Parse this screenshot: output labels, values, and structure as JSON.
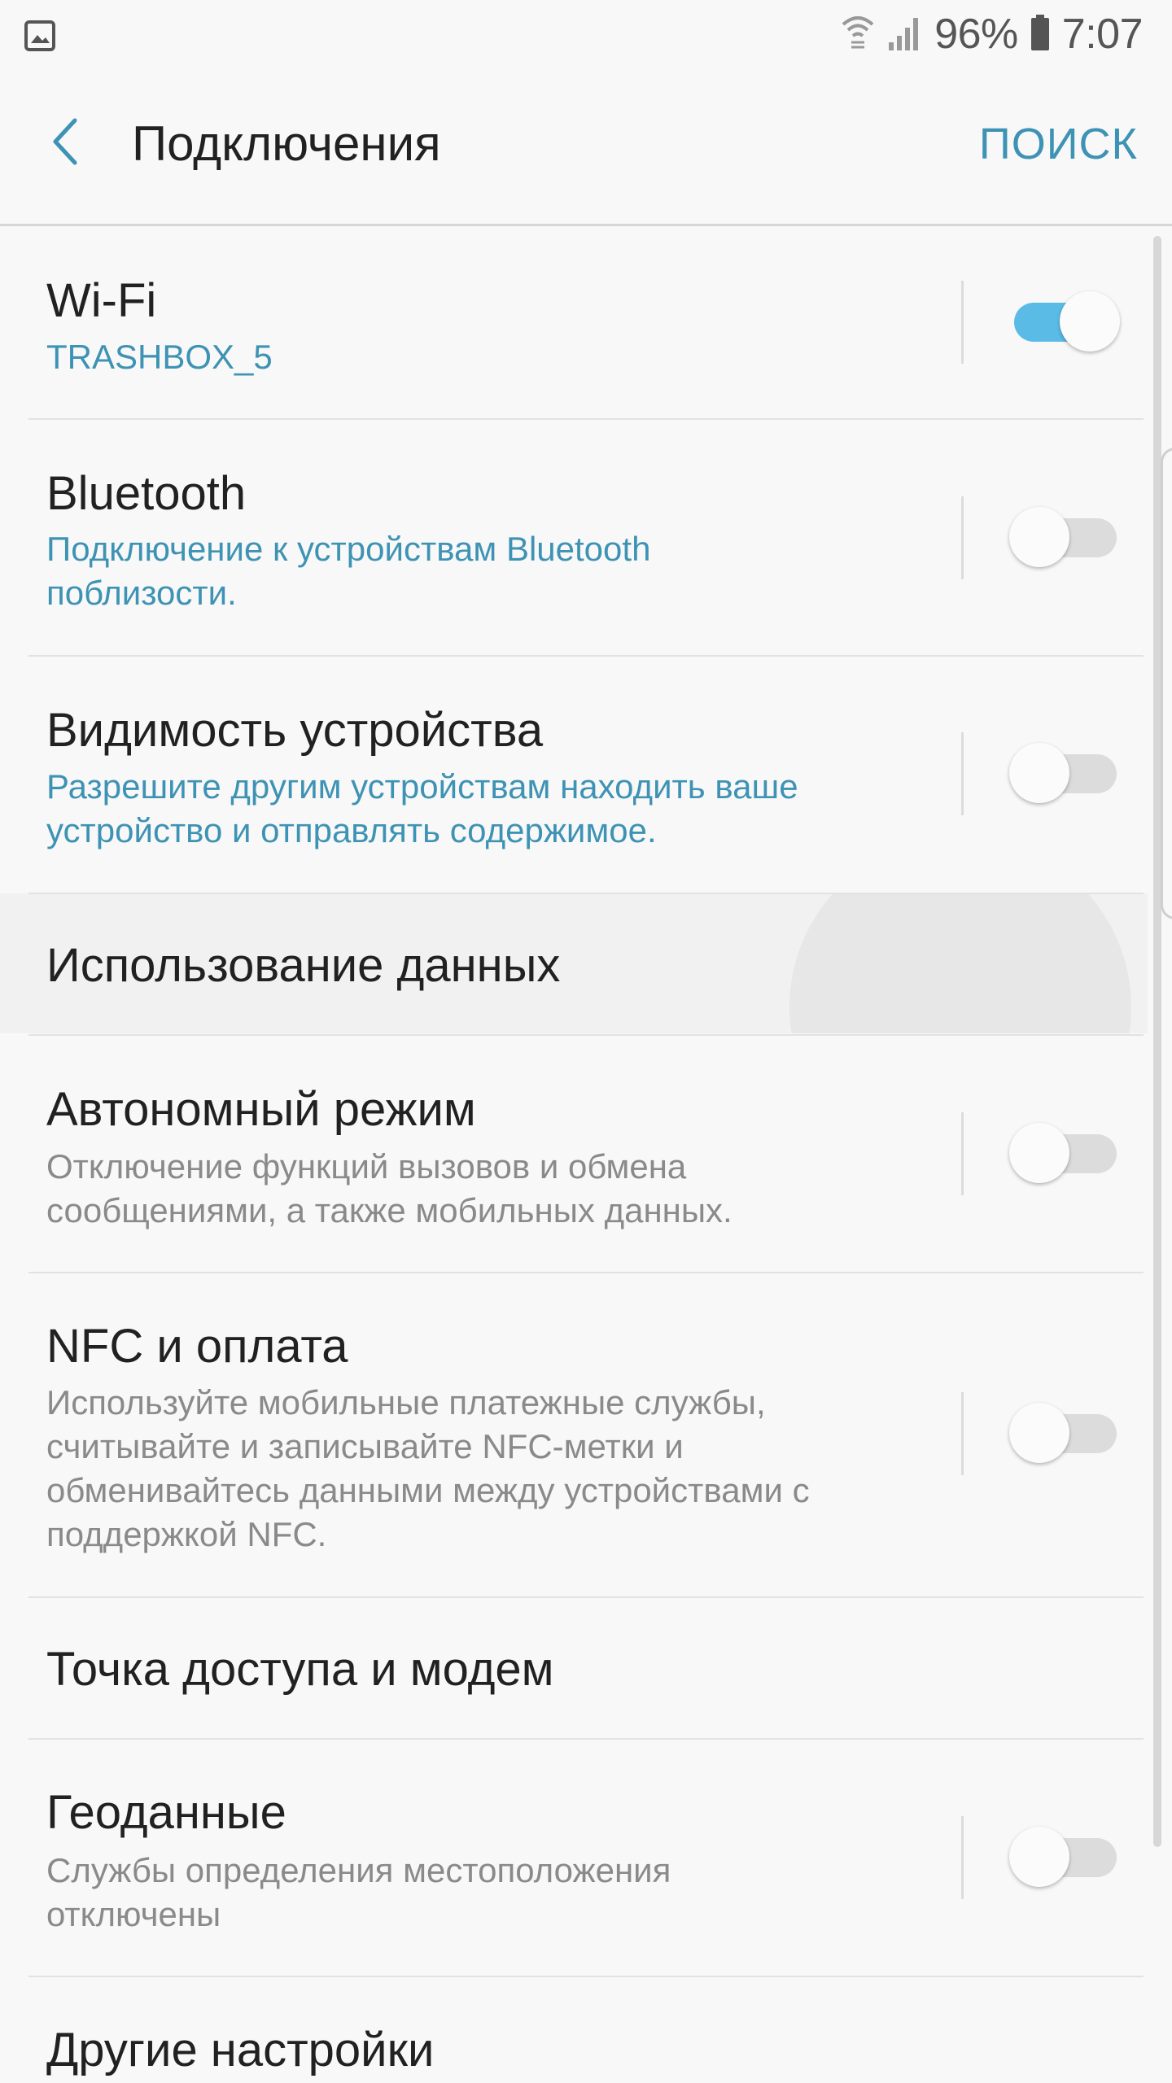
{
  "status_bar": {
    "left_icon": "image-notification-icon",
    "battery_percent": "96%",
    "time": "7:07",
    "icons": [
      "wifi-calling-icon",
      "signal-icon",
      "battery-icon"
    ]
  },
  "app_bar": {
    "back_icon": "chevron-left-icon",
    "title": "Подключения",
    "search_label": "ПОИСК"
  },
  "settings": [
    {
      "title": "Wi-Fi",
      "subtitle": "TRASHBOX_5",
      "subtitle_style": "accent",
      "toggle": true
    },
    {
      "title": "Bluetooth",
      "subtitle": "Подключение к устройствам Bluetooth\nпоблизости.",
      "subtitle_style": "accent",
      "toggle": false
    },
    {
      "title": "Видимость устройства",
      "subtitle": "Разрешите другим устройствам находить ваше\nустройство и отправлять содержимое.",
      "subtitle_style": "accent",
      "toggle": false
    },
    {
      "title": "Использование данных",
      "pressed": true
    },
    {
      "title": "Автономный режим",
      "subtitle": "Отключение функций вызовов и обмена\nсообщениями, а также мобильных данных.",
      "subtitle_style": "muted",
      "toggle": false
    },
    {
      "title": "NFC и оплата",
      "subtitle": "Используйте мобильные платежные службы,\nсчитывайте и записывайте NFC-метки и\nобменивайтесь данными между устройствами с\nподдержкой NFC.",
      "subtitle_style": "muted",
      "toggle": false
    },
    {
      "title": "Точка доступа и модем"
    },
    {
      "title": "Геоданные",
      "subtitle": "Службы определения местоположения\nотключены",
      "subtitle_style": "muted",
      "toggle": false
    },
    {
      "title": "Другие настройки"
    }
  ],
  "colors": {
    "accent": "#3e93b4",
    "toggle_on": "#5abce6",
    "toggle_off_track": "#dcdcdc",
    "background": "#f8f8f8",
    "muted_text": "#8a8a8a"
  }
}
